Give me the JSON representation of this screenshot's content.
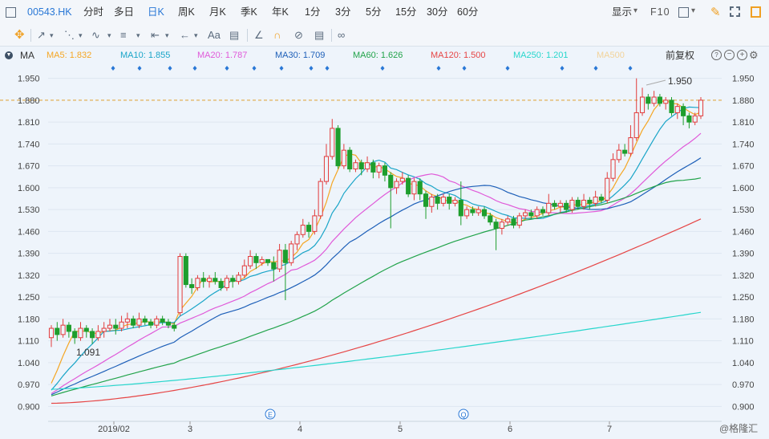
{
  "header": {
    "symbol": "00543.HK",
    "periods": [
      "分时",
      "多日",
      "日K",
      "周K",
      "月K",
      "季K",
      "年K",
      "1分",
      "3分",
      "5分",
      "15分",
      "30分",
      "60分"
    ],
    "active_period": "日K",
    "display_label": "显示",
    "f10_label": "F10"
  },
  "drawing_tools": {
    "text_tool_label": "Aa"
  },
  "indicators": {
    "name": "MA",
    "adjust_label": "前复权",
    "lines": [
      {
        "label": "MA5: 1.832",
        "color": "#f5a623"
      },
      {
        "label": "MA10: 1.855",
        "color": "#1aa5c8"
      },
      {
        "label": "MA20: 1.787",
        "color": "#e05ad9"
      },
      {
        "label": "MA30: 1.709",
        "color": "#1d5fb8"
      },
      {
        "label": "MA60: 1.626",
        "color": "#21a34a"
      },
      {
        "label": "MA120: 1.500",
        "color": "#e64545"
      },
      {
        "label": "MA250: 1.201",
        "color": "#27d6cc"
      },
      {
        "label": "MA500",
        "color": "#f2d39a"
      }
    ]
  },
  "chart_data": {
    "type": "candlestick",
    "ylim": [
      0.865,
      1.985
    ],
    "y_ticks": [
      "1.950",
      "1.880",
      "1.810",
      "1.740",
      "1.670",
      "1.600",
      "1.530",
      "1.460",
      "1.390",
      "1.320",
      "1.250",
      "1.180",
      "1.110",
      "1.040",
      "0.970",
      "0.900"
    ],
    "current_price": "1.880",
    "x_labels": [
      "2019/02",
      "3",
      "4",
      "5",
      "6",
      "7"
    ],
    "annotations": {
      "high": "1.950",
      "low": "1.091"
    },
    "event_markers": [
      "E",
      "Q"
    ],
    "watermark": "@格隆汇",
    "candles": [
      [
        1.12,
        1.15,
        1.16,
        1.09
      ],
      [
        1.15,
        1.13,
        1.17,
        1.11
      ],
      [
        1.13,
        1.16,
        1.18,
        1.12
      ],
      [
        1.16,
        1.14,
        1.17,
        1.12
      ],
      [
        1.14,
        1.12,
        1.15,
        1.1
      ],
      [
        1.12,
        1.15,
        1.17,
        1.11
      ],
      [
        1.15,
        1.14,
        1.16,
        1.12
      ],
      [
        1.14,
        1.12,
        1.15,
        1.1
      ],
      [
        1.12,
        1.14,
        1.16,
        1.11
      ],
      [
        1.14,
        1.15,
        1.17,
        1.12
      ],
      [
        1.15,
        1.16,
        1.18,
        1.14
      ],
      [
        1.16,
        1.15,
        1.18,
        1.13
      ],
      [
        1.15,
        1.17,
        1.19,
        1.14
      ],
      [
        1.17,
        1.18,
        1.2,
        1.15
      ],
      [
        1.18,
        1.16,
        1.19,
        1.15
      ],
      [
        1.16,
        1.18,
        1.2,
        1.15
      ],
      [
        1.18,
        1.17,
        1.19,
        1.16
      ],
      [
        1.17,
        1.16,
        1.18,
        1.15
      ],
      [
        1.16,
        1.18,
        1.19,
        1.15
      ],
      [
        1.18,
        1.17,
        1.19,
        1.16
      ],
      [
        1.17,
        1.16,
        1.18,
        1.15
      ],
      [
        1.16,
        1.15,
        1.17,
        1.14
      ],
      [
        1.2,
        1.38,
        1.39,
        1.19
      ],
      [
        1.38,
        1.29,
        1.39,
        1.28
      ],
      [
        1.29,
        1.28,
        1.31,
        1.26
      ],
      [
        1.28,
        1.31,
        1.32,
        1.27
      ],
      [
        1.31,
        1.3,
        1.33,
        1.28
      ],
      [
        1.3,
        1.31,
        1.32,
        1.28
      ],
      [
        1.31,
        1.3,
        1.33,
        1.29
      ],
      [
        1.3,
        1.28,
        1.31,
        1.27
      ],
      [
        1.28,
        1.31,
        1.32,
        1.27
      ],
      [
        1.31,
        1.3,
        1.32,
        1.28
      ],
      [
        1.3,
        1.32,
        1.33,
        1.29
      ],
      [
        1.32,
        1.35,
        1.37,
        1.31
      ],
      [
        1.35,
        1.38,
        1.4,
        1.34
      ],
      [
        1.38,
        1.36,
        1.39,
        1.34
      ],
      [
        1.36,
        1.37,
        1.38,
        1.35
      ],
      [
        1.37,
        1.36,
        1.37,
        1.35
      ],
      [
        1.36,
        1.34,
        1.38,
        1.3
      ],
      [
        1.34,
        1.4,
        1.42,
        1.33
      ],
      [
        1.4,
        1.36,
        1.42,
        1.24
      ],
      [
        1.36,
        1.42,
        1.43,
        1.35
      ],
      [
        1.42,
        1.45,
        1.46,
        1.4
      ],
      [
        1.45,
        1.48,
        1.5,
        1.44
      ],
      [
        1.48,
        1.46,
        1.49,
        1.44
      ],
      [
        1.46,
        1.51,
        1.53,
        1.45
      ],
      [
        1.51,
        1.62,
        1.63,
        1.5
      ],
      [
        1.62,
        1.7,
        1.74,
        1.61
      ],
      [
        1.7,
        1.79,
        1.82,
        1.69
      ],
      [
        1.79,
        1.67,
        1.8,
        1.66
      ],
      [
        1.67,
        1.72,
        1.74,
        1.66
      ],
      [
        1.72,
        1.66,
        1.73,
        1.65
      ],
      [
        1.66,
        1.68,
        1.69,
        1.65
      ],
      [
        1.68,
        1.66,
        1.69,
        1.64
      ],
      [
        1.66,
        1.68,
        1.7,
        1.65
      ],
      [
        1.68,
        1.65,
        1.69,
        1.63
      ],
      [
        1.65,
        1.67,
        1.68,
        1.63
      ],
      [
        1.67,
        1.64,
        1.68,
        1.62
      ],
      [
        1.64,
        1.6,
        1.65,
        1.47
      ],
      [
        1.6,
        1.62,
        1.63,
        1.58
      ],
      [
        1.62,
        1.63,
        1.65,
        1.61
      ],
      [
        1.63,
        1.58,
        1.64,
        1.57
      ],
      [
        1.58,
        1.62,
        1.63,
        1.56
      ],
      [
        1.62,
        1.58,
        1.63,
        1.56
      ],
      [
        1.58,
        1.54,
        1.59,
        1.5
      ],
      [
        1.54,
        1.57,
        1.58,
        1.52
      ],
      [
        1.57,
        1.55,
        1.58,
        1.53
      ],
      [
        1.55,
        1.57,
        1.58,
        1.54
      ],
      [
        1.57,
        1.55,
        1.58,
        1.53
      ],
      [
        1.55,
        1.56,
        1.57,
        1.54
      ],
      [
        1.56,
        1.51,
        1.62,
        1.48
      ],
      [
        1.51,
        1.53,
        1.54,
        1.5
      ],
      [
        1.53,
        1.52,
        1.54,
        1.51
      ],
      [
        1.52,
        1.53,
        1.54,
        1.51
      ],
      [
        1.53,
        1.51,
        1.54,
        1.5
      ],
      [
        1.51,
        1.49,
        1.52,
        1.48
      ],
      [
        1.49,
        1.47,
        1.5,
        1.4
      ],
      [
        1.47,
        1.49,
        1.5,
        1.45
      ],
      [
        1.49,
        1.5,
        1.51,
        1.48
      ],
      [
        1.5,
        1.48,
        1.51,
        1.47
      ],
      [
        1.48,
        1.51,
        1.52,
        1.47
      ],
      [
        1.51,
        1.52,
        1.53,
        1.5
      ],
      [
        1.52,
        1.51,
        1.53,
        1.5
      ],
      [
        1.51,
        1.53,
        1.54,
        1.5
      ],
      [
        1.53,
        1.52,
        1.54,
        1.51
      ],
      [
        1.52,
        1.55,
        1.58,
        1.51
      ],
      [
        1.55,
        1.54,
        1.56,
        1.53
      ],
      [
        1.54,
        1.55,
        1.56,
        1.52
      ],
      [
        1.55,
        1.53,
        1.56,
        1.52
      ],
      [
        1.53,
        1.56,
        1.57,
        1.52
      ],
      [
        1.56,
        1.54,
        1.57,
        1.53
      ],
      [
        1.54,
        1.56,
        1.58,
        1.53
      ],
      [
        1.56,
        1.55,
        1.57,
        1.53
      ],
      [
        1.55,
        1.57,
        1.59,
        1.54
      ],
      [
        1.57,
        1.56,
        1.58,
        1.55
      ],
      [
        1.56,
        1.63,
        1.65,
        1.55
      ],
      [
        1.63,
        1.69,
        1.71,
        1.62
      ],
      [
        1.69,
        1.72,
        1.74,
        1.68
      ],
      [
        1.72,
        1.71,
        1.74,
        1.7
      ],
      [
        1.71,
        1.76,
        1.8,
        1.7
      ],
      [
        1.76,
        1.84,
        1.95,
        1.75
      ],
      [
        1.84,
        1.89,
        1.92,
        1.83
      ],
      [
        1.89,
        1.87,
        1.9,
        1.85
      ],
      [
        1.87,
        1.89,
        1.91,
        1.86
      ],
      [
        1.89,
        1.87,
        1.9,
        1.86
      ],
      [
        1.87,
        1.88,
        1.89,
        1.85
      ],
      [
        1.88,
        1.84,
        1.89,
        1.83
      ],
      [
        1.84,
        1.86,
        1.87,
        1.82
      ],
      [
        1.86,
        1.83,
        1.87,
        1.8
      ],
      [
        1.83,
        1.81,
        1.84,
        1.79
      ],
      [
        1.81,
        1.83,
        1.84,
        1.8
      ],
      [
        1.83,
        1.88,
        1.89,
        1.82
      ]
    ]
  }
}
